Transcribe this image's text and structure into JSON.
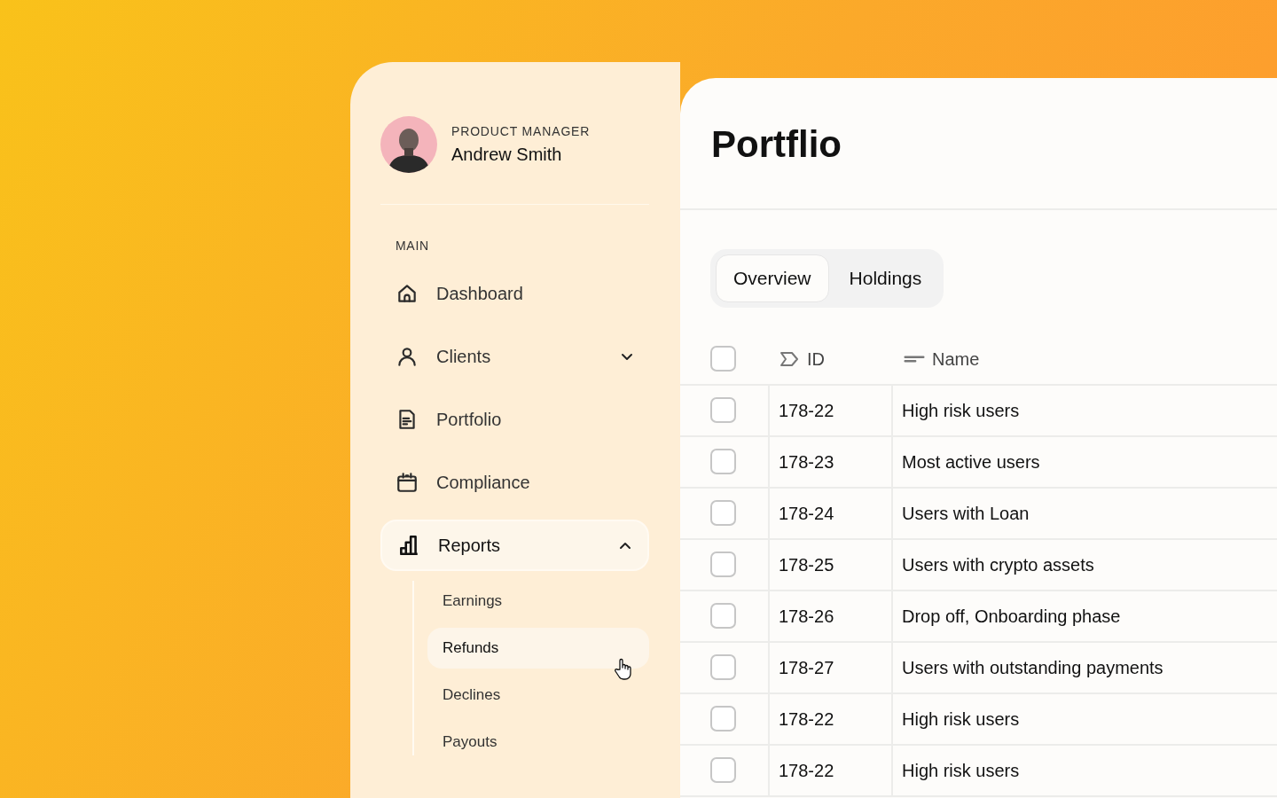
{
  "user": {
    "role": "PRODUCT MANAGER",
    "name": "Andrew Smith"
  },
  "sidebar": {
    "section": "MAIN",
    "items": [
      {
        "label": "Dashboard",
        "kind": "home",
        "selected": false
      },
      {
        "label": "Clients",
        "kind": "user",
        "selected": false,
        "expanded": false
      },
      {
        "label": "Portfolio",
        "kind": "document",
        "selected": false
      },
      {
        "label": "Compliance",
        "kind": "calendar",
        "selected": false
      },
      {
        "label": "Reports",
        "kind": "chart",
        "selected": true,
        "expanded": true,
        "children": [
          {
            "label": "Earnings",
            "selected": false
          },
          {
            "label": "Refunds",
            "selected": true
          },
          {
            "label": "Declines",
            "selected": false
          },
          {
            "label": "Payouts",
            "selected": false
          }
        ]
      }
    ]
  },
  "page": {
    "title": "Portflio"
  },
  "tabs": [
    {
      "label": "Overview",
      "selected": true
    },
    {
      "label": "Holdings",
      "selected": false
    }
  ],
  "table": {
    "all_checked": false,
    "columns": [
      {
        "label": "ID",
        "kind": "tag"
      },
      {
        "label": "Name",
        "kind": "lines"
      }
    ],
    "rows": [
      {
        "id": "178-22",
        "name": "High risk users",
        "checked": false
      },
      {
        "id": "178-23",
        "name": "Most active users",
        "checked": false
      },
      {
        "id": "178-24",
        "name": "Users with Loan",
        "checked": false
      },
      {
        "id": "178-25",
        "name": "Users with crypto assets",
        "checked": false
      },
      {
        "id": "178-26",
        "name": "Drop off, Onboarding phase",
        "checked": false
      },
      {
        "id": "178-27",
        "name": "Users with outstanding payments",
        "checked": false
      },
      {
        "id": "178-22",
        "name": "High risk users",
        "checked": false
      },
      {
        "id": "178-22",
        "name": "High risk users",
        "checked": false
      }
    ]
  }
}
